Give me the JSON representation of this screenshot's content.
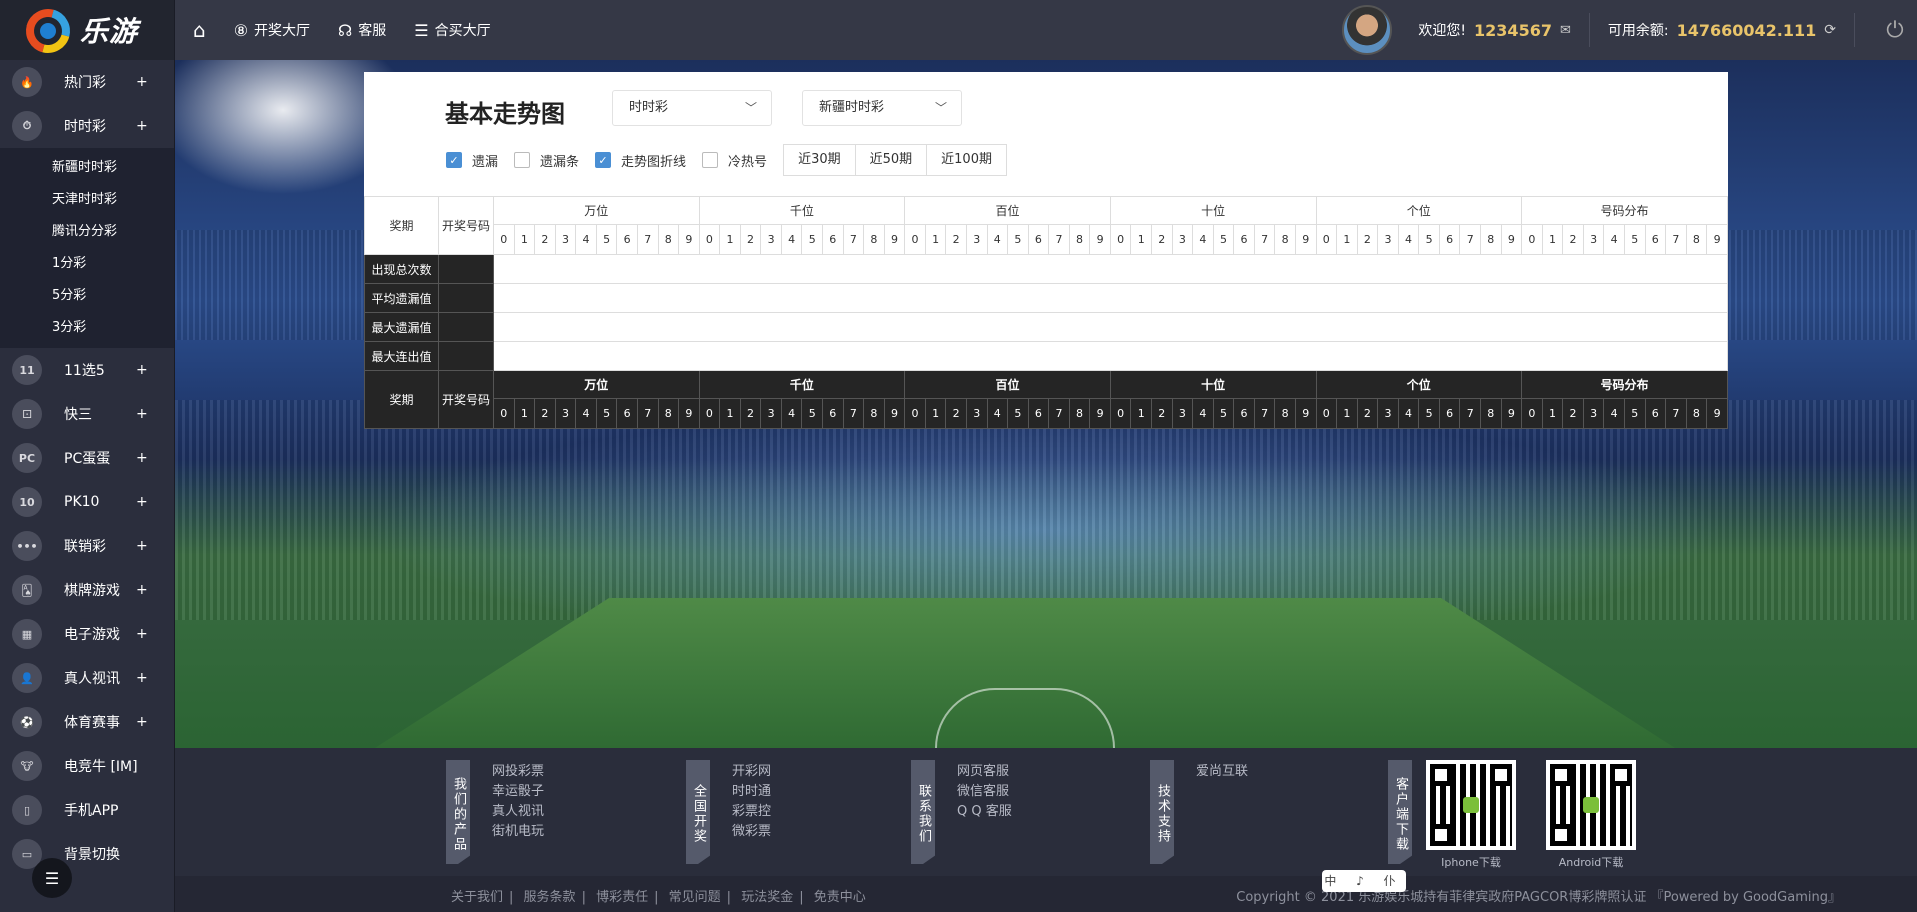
{
  "brand": {
    "name": "乐游"
  },
  "topnav": {
    "items": [
      {
        "label": "开奖大厅",
        "icon": "lottery-ball-icon"
      },
      {
        "label": "客服",
        "icon": "headset-icon"
      },
      {
        "label": "合买大厅",
        "icon": "list-icon"
      }
    ],
    "welcome": "欢迎您!",
    "username": "1234567",
    "balance_label": "可用余额:",
    "balance": "147660042.111"
  },
  "sidebar": {
    "items": [
      {
        "label": "热门彩",
        "icon": "fire-icon",
        "plus": "+"
      },
      {
        "label": "时时彩",
        "icon": "ssc-icon",
        "plus": "+"
      },
      {
        "label": "11选5",
        "icon": "11x5-icon",
        "plus": "+"
      },
      {
        "label": "快三",
        "icon": "dice-icon",
        "plus": "+"
      },
      {
        "label": "PC蛋蛋",
        "icon": "pcdd-icon",
        "plus": "+"
      },
      {
        "label": "PK10",
        "icon": "pk10-icon",
        "plus": "+"
      },
      {
        "label": "联销彩",
        "icon": "dots-icon",
        "plus": "+"
      },
      {
        "label": "棋牌游戏",
        "icon": "cards-icon",
        "plus": "+"
      },
      {
        "label": "电子游戏",
        "icon": "slot-icon",
        "plus": "+"
      },
      {
        "label": "真人视讯",
        "icon": "dealer-icon",
        "plus": "+"
      },
      {
        "label": "体育赛事",
        "icon": "soccer-icon",
        "plus": "+"
      },
      {
        "label": "电竞牛 [IM]",
        "icon": "bull-icon"
      },
      {
        "label": "手机APP",
        "icon": "phone-icon"
      },
      {
        "label": "背景切换",
        "icon": "monitor-icon"
      }
    ],
    "submenu": [
      "新疆时时彩",
      "天津时时彩",
      "腾讯分分彩",
      "1分彩",
      "5分彩",
      "3分彩"
    ]
  },
  "trend": {
    "title": "基本走势图",
    "select_type": "时时彩",
    "select_game": "新疆时时彩",
    "options": [
      {
        "label": "遗漏",
        "checked": true
      },
      {
        "label": "遗漏条",
        "checked": false
      },
      {
        "label": "走势图折线",
        "checked": true
      },
      {
        "label": "冷热号",
        "checked": false
      }
    ],
    "periods": [
      "近30期",
      "近50期",
      "近100期"
    ],
    "col_period": "奖期",
    "col_code": "开奖号码",
    "groups": [
      "万位",
      "千位",
      "百位",
      "十位",
      "个位",
      "号码分布"
    ],
    "digits": [
      "0",
      "1",
      "2",
      "3",
      "4",
      "5",
      "6",
      "7",
      "8",
      "9"
    ],
    "stats": [
      "出现总次数",
      "平均遗漏值",
      "最大遗漏值",
      "最大连出值"
    ]
  },
  "footer": {
    "columns": [
      {
        "tag": "我们的产品",
        "links": [
          "网投彩票",
          "幸运骰子",
          "真人视讯",
          "街机电玩"
        ]
      },
      {
        "tag": "全国开奖",
        "links": [
          "开彩网",
          "时时通",
          "彩票控",
          "微彩票"
        ]
      },
      {
        "tag": "联系我们",
        "links": [
          "网页客服",
          "微信客服",
          "Q Q 客服"
        ]
      },
      {
        "tag": "技术支持",
        "links": [
          "爱尚互联"
        ]
      }
    ],
    "download_tag": "客户端下载",
    "qr_iphone": "Iphone下载",
    "qr_android": "Android下载",
    "bottom_links": [
      "关于我们",
      "服务条款",
      "博彩责任",
      "常见问题",
      "玩法奖金",
      "免责中心"
    ],
    "copyright": "Copyright © 2021 乐游娱乐城持有菲律宾政府PAGCOR博彩牌照认证 『Powered by GoodGaming』",
    "lang_badge": "中 ♪ 仆"
  },
  "colors": {
    "accent_gold": "#e9c46a",
    "checkbox_blue": "#4a8fd4",
    "sidebar_bg": "#2b2e3d"
  }
}
